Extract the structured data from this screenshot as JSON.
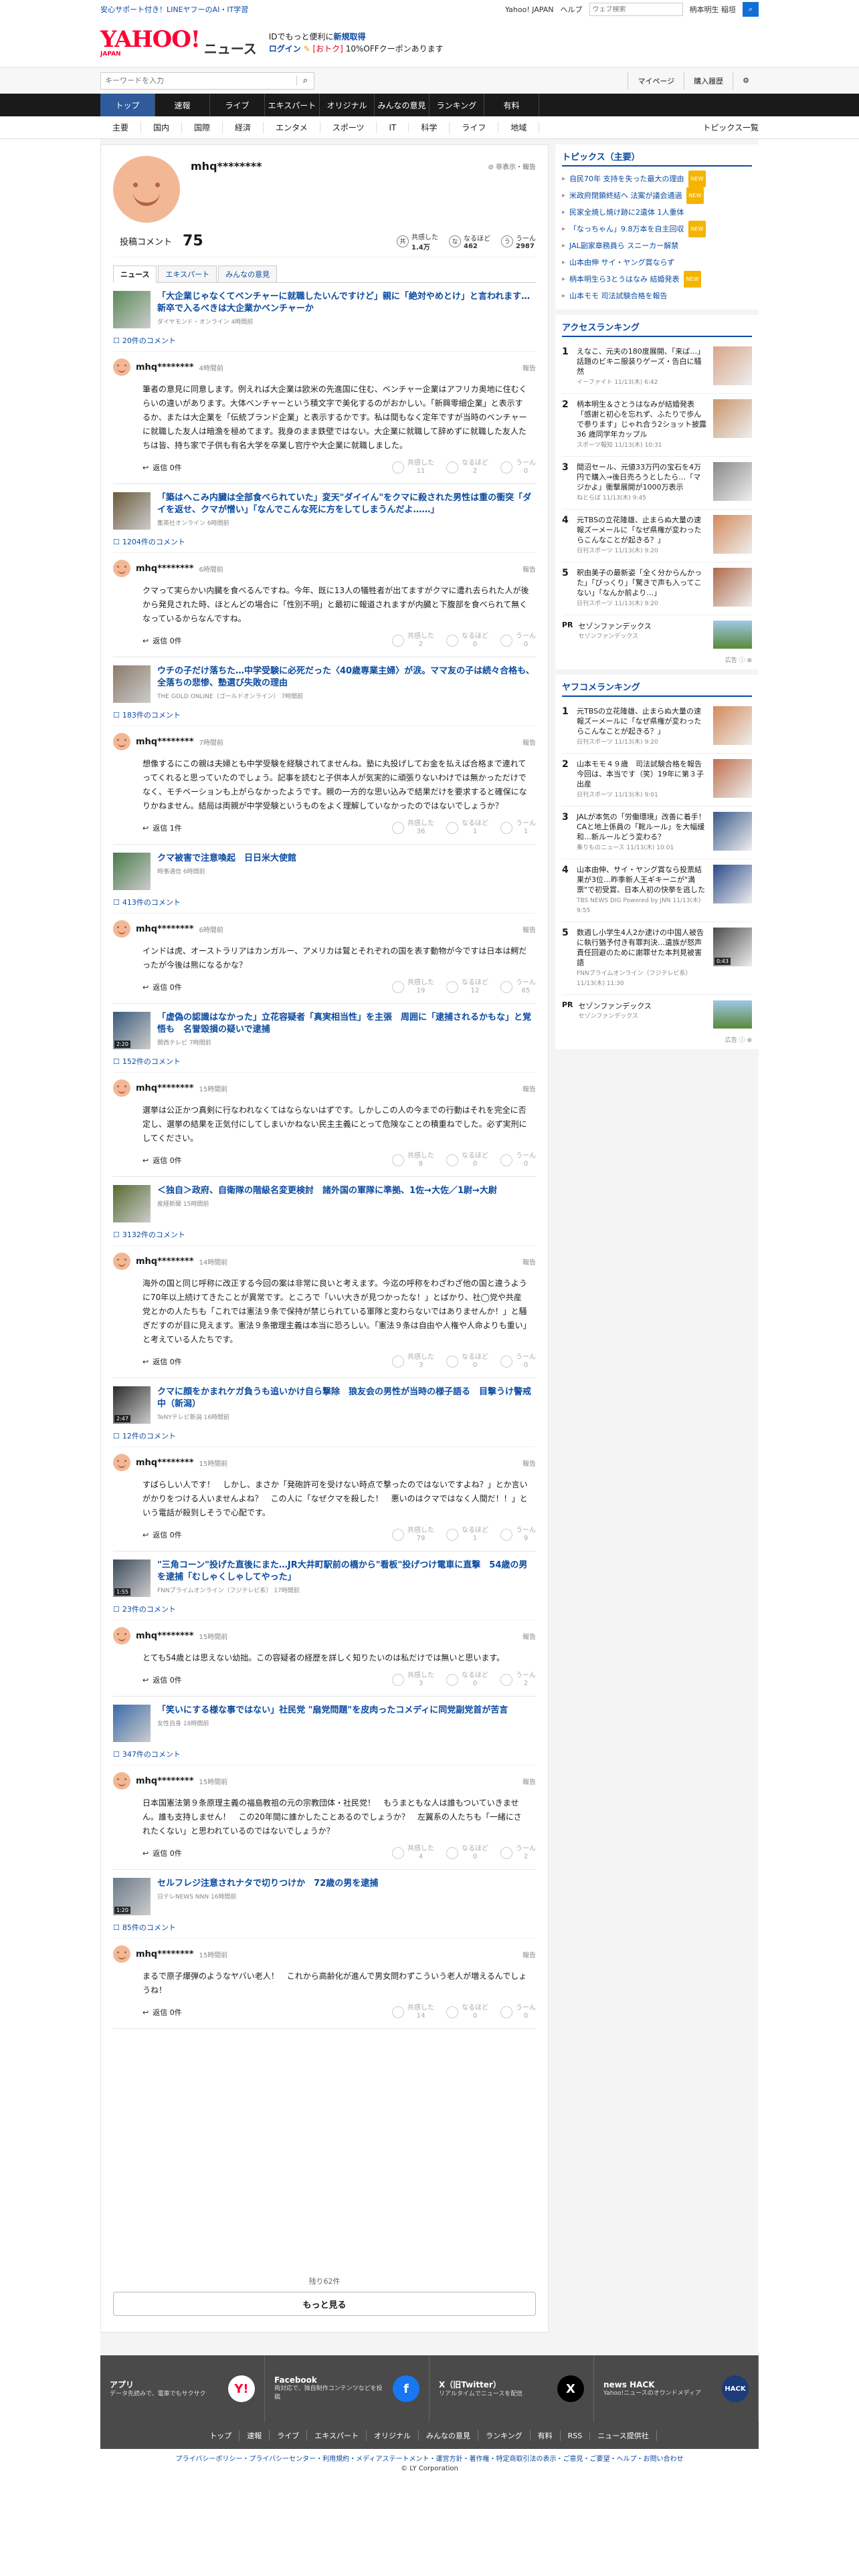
{
  "top": {
    "left": "安心サポート付き！LINEヤフーのAI・IT学習",
    "links": [
      "Yahoo! JAPAN",
      "ヘルプ"
    ],
    "search_placeholder": "ウェブ検索",
    "region": "柄本明生 稲垣"
  },
  "header": {
    "logo": "YAHOO!",
    "logo_sub": "JAPAN",
    "logo_news": "ニュース",
    "promo1": "IDでもっと便利に",
    "promo1_link": "新規取得",
    "login": "ログイン",
    "promo2_red": "[おトク]",
    "promo2": "10%OFFクーポンあります"
  },
  "toolbar": {
    "kw_placeholder": "キーワードを入力",
    "mypage": "マイページ",
    "purchase": "購入履歴"
  },
  "mainnav": [
    "トップ",
    "速報",
    "ライブ",
    "エキスパート",
    "オリジナル",
    "みんなの意見",
    "ランキング",
    "有料"
  ],
  "subnav": [
    "主要",
    "国内",
    "国際",
    "経済",
    "エンタメ",
    "スポーツ",
    "IT",
    "科学",
    "ライフ",
    "地域"
  ],
  "subnav_right": "トピックス一覧",
  "profile": {
    "name": "mhq********",
    "non_display": "非表示・報告",
    "comment_label": "投稿コメント",
    "comment_count": "75",
    "stats": [
      {
        "icon": "共",
        "label": "共感した",
        "value": "1.4万"
      },
      {
        "icon": "な",
        "label": "なるほど",
        "value": "462"
      },
      {
        "icon": "う",
        "label": "うーん",
        "value": "2987"
      }
    ]
  },
  "tabs": [
    "ニュース",
    "エキスパート",
    "みんなの意見"
  ],
  "entries": [
    {
      "title": "「大企業じゃなくてベンチャーに就職したいんですけど」親に「絶対やめとけ」と言われます…　新卒で入るべきは大企業かベンチャーか",
      "source": "ダイヤモンド・オンライン 4時間前",
      "count": "20件のコメント",
      "user": "mhq********",
      "time": "4時間前",
      "body": "筆者の意見に同意します。例えれば大企業は欧米の先進国に住む、ベンチャー企業はアフリカ奥地に住むくらいの違いがあります。大体ベンチャーという積文字で美化するのがおかしい。「新興零細企業」と表示するか、または大企業を「伝統ブランド企業」と表示するかです。私は間もなく定年ですが当時のベンチャーに就職した友人は暗澹を極めてます。我身のまま鉄壁ではない。大企業に就職して辞めずに就職した友人たちは皆、持ち家で子供も有名大学を卒業し官庁や大企業に就職しました。",
      "reply": "返信 0件",
      "r": [
        "11",
        "2",
        "0"
      ],
      "thumb": "#5a8a5a"
    },
    {
      "title": "「築はへこみ内臓は全部食べられていた」変天\"ダイイん\"をクマに殺された男性は重の衝突「ダイを返せ、クマが憎い」「なんでこんな死に方をしてしまうんだよ……」",
      "source": "集英社オンライン 6時間前",
      "count": "1204件のコメント",
      "user": "mhq********",
      "time": "6時間前",
      "body": "クマって実らかい内臓を食べるんですね。今年、既に13人の犠牲者が出てますがクマに遭れ去られた人が後から発見された時、ほとんどの場合に「性別不明」と最初に報道されますが内臓と下腹部を食べられて無くなっているからなんですね。",
      "reply": "返信 0件",
      "r": [
        "2",
        "0",
        "0"
      ],
      "thumb": "#6b5a3a"
    },
    {
      "title": "ウチの子だけ落ちた…中学受験に必死だった〈40歳専業主婦〉が涙。ママ友の子は続々合格も、全落ちの悲惨、塾選び失敗の理由",
      "source": "THE GOLD ONLINE（ゴールドオンライン） 7時間前",
      "count": "183件のコメント",
      "user": "mhq********",
      "time": "7時間前",
      "body": "想像するにこの親は夫婦とも中学受験を経験されてませんね。塾に丸投げしてお金を払えば合格まで連れてってくれると思っていたのでしょう。記事を読むと子供本人が気実的に頑張りないわけでは無かっただけでなく、モチベーションも上がらなかったようです。親の一方的な思い込みで結果だけを要求すると確保になりかねません。結局は両親が中学受験というものをよく理解していなかったのではないでしょうか？",
      "reply": "返信 1件",
      "r": [
        "36",
        "1",
        "1"
      ],
      "thumb": "#8a7a6a"
    },
    {
      "title": "クマ被害で注意喚起　日日米大使館",
      "source": "時事通信 6時間前",
      "count": "413件のコメント",
      "user": "mhq********",
      "time": "6時間前",
      "body": "インドは虎、オーストラリアはカンガルー、アメリカは鷲とそれぞれの国を表す動物が今ですは日本は鰐だったが今後は熊になるかな？",
      "reply": "返信 0件",
      "r": [
        "19",
        "12",
        "65"
      ],
      "thumb": "#4a7a4a"
    },
    {
      "title": "「虚偽の認識はなかった」立花容疑者「真実相当性」を主張　周囲に「逮捕されるかもな」と覚悟も　名誉毀損の疑いで逮捕",
      "source": "関西テレビ 7時間前",
      "count": "152件のコメント",
      "user": "mhq********",
      "time": "15時間前",
      "body": "選挙は公正かつ真剣に行なわれなくてはならないはずです。しかしこの人の今までの行動はそれを完全に否定し、選挙の結果を正気付にしてしまいかねない民主主義にとって危険なことの積重ねでした。必ず実刑にしてください。",
      "reply": "返信 0件",
      "r": [
        "8",
        "0",
        "0"
      ],
      "thumb": "#3a5a7a",
      "video": "2:20"
    },
    {
      "title": "＜独自＞政府、自衛隊の階級名変更検討　諸外国の軍隊に準拠、1佐→大佐／1尉→大尉",
      "source": "産経新聞 15時間前",
      "count": "3132件のコメント",
      "user": "mhq********",
      "time": "14時間前",
      "body": "海外の国と同じ呼称に改正する今回の案は非常に良いと考えます。今迄の呼称をわざわざ他の国と違うように70年以上続けてきたことが異常です。ところで「いい大きが見つかったな！」とばかり、社◯党や共産党とかの人たちも「これでは憲法９条で保持が禁じられている軍隊と変わらないではありませんか！」と騒ぎだすのが目に見えます。憲法９条撤理主義は本当に恐ろしい。「憲法９条は自由や人権や人命よりも重い」と考えている人たちです。",
      "reply": "返信 0件",
      "r": [
        "3",
        "0",
        "0"
      ],
      "thumb": "#556b2f"
    },
    {
      "title": "クマに顔をかまれケガ負うも追いかけ自ら撃除　狼友会の男性が当時の様子語る　目撃うけ警戒中（新潟）",
      "source": "TeNYテレビ新潟 16時間前",
      "count": "12件のコメント",
      "user": "mhq********",
      "time": "15時間前",
      "body": "すばらしい人です！　しかし、まさか「発砲許可を受けない時点で撃ったのではないですよね？」とか言いがかりをつける人いませんよね？　この人に「なぜクマを殺した！　悪いのはクマではなく人間だ！！」という電話が殺到しそうで心配です。",
      "reply": "返信 0件",
      "r": [
        "79",
        "1",
        "9"
      ],
      "thumb": "#2a2a2a",
      "video": "2:47"
    },
    {
      "title": "\"三角コーン\"投げた直後にまた…JR大井町駅前の橋から\"看板\"投げつけ電車に直撃　54歳の男を逮捕「むしゃくしゃしてやった」",
      "source": "FNNプライムオンライン（フジテレビ系） 17時間前",
      "count": "23件のコメント",
      "user": "mhq********",
      "time": "15時間前",
      "body": "とても54歳とは思えない幼拙。この容疑者の経歴を詳しく知りたいのは私だけでは無いと思います。",
      "reply": "返信 0件",
      "r": [
        "3",
        "0",
        "2"
      ],
      "thumb": "#3a4a5a",
      "video": "1:55"
    },
    {
      "title": "「笑いにする様な事ではない」社民党 \"扇党問題\"を皮肉ったコメディに同党副党首が苦言",
      "source": "女性自身 18時間前",
      "count": "347件のコメント",
      "user": "mhq********",
      "time": "15時間前",
      "body": "日本国憲法第９条原理主義の福島教祖の元の宗教団体・社民党！　もうまともな人は誰もついていきません。誰も支持しません！　この20年間に誰かしたことあるのでしょうか？　左翼系の人たちも「一緒にされたくない」と思われているのではないでしょうか？",
      "reply": "返信 0件",
      "r": [
        "4",
        "0",
        "2"
      ],
      "thumb": "#3a6aaa"
    },
    {
      "title": "セルフレジ注意されナタで切りつけか　72歳の男を逮捕",
      "source": "日テレNEWS NNN 16時間前",
      "count": "85件のコメント",
      "user": "mhq********",
      "time": "15時間前",
      "body": "まるで原子爆弾のようなヤバい老人！　これから高齢化が進んで男女問わずこういう老人が増えるんでしょうね！",
      "reply": "返信 0件",
      "r": [
        "14",
        "0",
        "0"
      ],
      "thumb": "#6a7a8a",
      "video": "1:20"
    }
  ],
  "reactions": [
    "共感した",
    "なるほど",
    "うーん"
  ],
  "more": {
    "remaining": "残り62件",
    "button": "もっと見る"
  },
  "right": {
    "topics_head": "トピックス（主要）",
    "topics": [
      {
        "t": "自民70年 支持を失った最大の理由",
        "new": true
      },
      {
        "t": "米政府閉鎖終結へ 法案が議会通過",
        "new": true
      },
      {
        "t": "民家全焼し焼け跡に2遺体 1人重体",
        "new": false
      },
      {
        "t": "「なっちゃん」9.8万本を自主回収",
        "new": true
      },
      {
        "t": "JAL副家章務員ら スニーカー解禁",
        "new": false
      },
      {
        "t": "山本由伸 サイ・ヤング賞ならず",
        "new": false
      },
      {
        "t": "柄本明生ら3とうはなみ 結婚発表",
        "new": true
      },
      {
        "t": "山本モモ 司法試験合格を報告",
        "new": false
      }
    ],
    "new_label": "NEW",
    "access_head": "アクセスランキング",
    "access": [
      {
        "n": "1",
        "t": "えなこ、元夫の180度展開、「来ば…」話題のビキニ服装りゲーズ・告白に騒然",
        "s": "イーファイト 11/13(木) 6:42",
        "c": "#d9a58a"
      },
      {
        "n": "2",
        "t": "柄本明生＆さとうはなみが結婚発表「感謝と初心を忘れず、ふたりで歩んで参ります」じゃれ合う2ショット披露　36 歳同学年カップル",
        "s": "スポーツ報知 11/13(木) 10:31",
        "c": "#c9956a"
      },
      {
        "n": "3",
        "t": "間沼セール、元値33万円の宝石を4万円で購入→後日売ろうとしたら…「マジかよ」衝撃展開が1000万表示",
        "s": "ねとらぼ 11/13(木) 9:45",
        "c": "#888"
      },
      {
        "n": "4",
        "t": "元TBSの立花隆雄、止まらぬ大量の速報ズーメールに「なぜ県権が変わったらこんなことが起きる？」",
        "s": "日刊スポーツ 11/13(木) 9:20",
        "c": "#d48a5a"
      },
      {
        "n": "5",
        "t": "釈由美子の最新姿「全く分からんかった」「びっくり」「驚きで声も入ってこない」「なんか前より…」",
        "s": "日刊スポーツ 11/13(木) 9:20",
        "c": "#b06a4a"
      }
    ],
    "pr_label": "PR",
    "pr_title": "セゾンファンデックス",
    "pr_sub": "セゾンファンデックス",
    "ad_label": "広告",
    "yafoo_head": "ヤフコメランキング",
    "yafoo": [
      {
        "n": "1",
        "t": "元TBSの立花隆雄、止まらぬ大量の速報ズーメールに「なぜ県権が変わったらこんなことが起きる？」",
        "s": "日刊スポーツ 11/13(木) 9:20",
        "c": "#d48a5a"
      },
      {
        "n": "2",
        "t": "山本モモ４９歳　司法試験合格を報告　今回は、本当です（笑）19年に第３子出産",
        "s": "日刊スポーツ 11/13(木) 9:01",
        "c": "#c07050"
      },
      {
        "n": "3",
        "t": "JALが本気の「労働環境」改善に着手！ CAと地上係員の「靴ルール」を大幅緩和…新ルールどう変わる？",
        "s": "乗りものニュース 11/13(木) 10:01",
        "c": "#3a5a8a"
      },
      {
        "n": "4",
        "t": "山本由伸、サイ・ヤング賞なら投票結果が3位…昨季新人王ギキーニが\"満票\"で初受賞、日本人初の快挙を逃した",
        "s": "TBS NEWS DIG Powered by JNN 11/13(木) 9:55",
        "c": "#2a4a8a"
      },
      {
        "n": "5",
        "t": "数週し小学生4人2か逮けの中国人被告に執行猶予付き有罪判決…遺族が怒声 責任回避のために謝罪せた本判見被害語",
        "s": "FNNプライムオンライン（フジテレビ系） 11/13(木) 11:30",
        "c": "#4a4a4a",
        "video": "0:43"
      }
    ]
  },
  "footer_apps": [
    {
      "name": "アプリ",
      "desc": "データ先読みで、電車でもサクサク",
      "icon": "Y!",
      "color": "#ffffff",
      "fg": "#ff0033"
    },
    {
      "name": "Facebook",
      "desc": "両対応で、独自制作コンテンツなどを投稿",
      "icon": "f",
      "color": "#1877f2",
      "fg": "#ffffff"
    },
    {
      "name": "X（旧Twitter）",
      "desc": "リアルタイムでニュースを配信",
      "icon": "X",
      "color": "#000000",
      "fg": "#ffffff"
    },
    {
      "name": "news HACK",
      "desc": "Yahoo!ニュースのオウンドメディア",
      "icon": "HACK",
      "color": "#1b3b7a",
      "fg": "#ffffff"
    }
  ],
  "footer_nav": [
    "トップ",
    "速報",
    "ライブ",
    "エキスパート",
    "オリジナル",
    "みんなの意見",
    "ランキング",
    "有料",
    "RSS",
    "ニュース提供社"
  ],
  "footer_links": "プライバシーポリシー・プライバシーセンター・利用規約・メディアステートメント・運営方針・著作権・特定商取引法の表示・ご意見・ご要望・ヘルプ・お問い合わせ",
  "copyright": "© LY Corporation"
}
